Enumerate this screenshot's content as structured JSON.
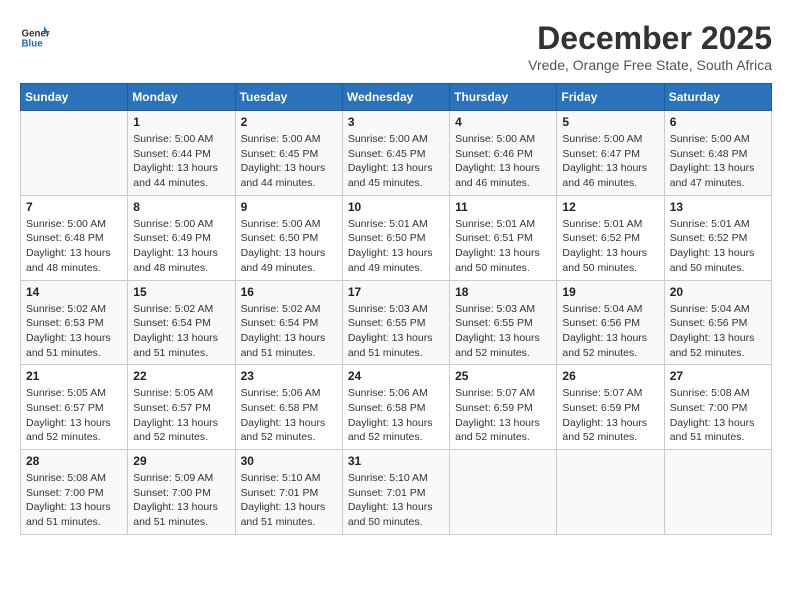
{
  "header": {
    "logo_general": "General",
    "logo_blue": "Blue",
    "month_title": "December 2025",
    "location": "Vrede, Orange Free State, South Africa"
  },
  "days_of_week": [
    "Sunday",
    "Monday",
    "Tuesday",
    "Wednesday",
    "Thursday",
    "Friday",
    "Saturday"
  ],
  "weeks": [
    [
      {
        "day": "",
        "info": ""
      },
      {
        "day": "1",
        "info": "Sunrise: 5:00 AM\nSunset: 6:44 PM\nDaylight: 13 hours\nand 44 minutes."
      },
      {
        "day": "2",
        "info": "Sunrise: 5:00 AM\nSunset: 6:45 PM\nDaylight: 13 hours\nand 44 minutes."
      },
      {
        "day": "3",
        "info": "Sunrise: 5:00 AM\nSunset: 6:45 PM\nDaylight: 13 hours\nand 45 minutes."
      },
      {
        "day": "4",
        "info": "Sunrise: 5:00 AM\nSunset: 6:46 PM\nDaylight: 13 hours\nand 46 minutes."
      },
      {
        "day": "5",
        "info": "Sunrise: 5:00 AM\nSunset: 6:47 PM\nDaylight: 13 hours\nand 46 minutes."
      },
      {
        "day": "6",
        "info": "Sunrise: 5:00 AM\nSunset: 6:48 PM\nDaylight: 13 hours\nand 47 minutes."
      }
    ],
    [
      {
        "day": "7",
        "info": "Sunrise: 5:00 AM\nSunset: 6:48 PM\nDaylight: 13 hours\nand 48 minutes."
      },
      {
        "day": "8",
        "info": "Sunrise: 5:00 AM\nSunset: 6:49 PM\nDaylight: 13 hours\nand 48 minutes."
      },
      {
        "day": "9",
        "info": "Sunrise: 5:00 AM\nSunset: 6:50 PM\nDaylight: 13 hours\nand 49 minutes."
      },
      {
        "day": "10",
        "info": "Sunrise: 5:01 AM\nSunset: 6:50 PM\nDaylight: 13 hours\nand 49 minutes."
      },
      {
        "day": "11",
        "info": "Sunrise: 5:01 AM\nSunset: 6:51 PM\nDaylight: 13 hours\nand 50 minutes."
      },
      {
        "day": "12",
        "info": "Sunrise: 5:01 AM\nSunset: 6:52 PM\nDaylight: 13 hours\nand 50 minutes."
      },
      {
        "day": "13",
        "info": "Sunrise: 5:01 AM\nSunset: 6:52 PM\nDaylight: 13 hours\nand 50 minutes."
      }
    ],
    [
      {
        "day": "14",
        "info": "Sunrise: 5:02 AM\nSunset: 6:53 PM\nDaylight: 13 hours\nand 51 minutes."
      },
      {
        "day": "15",
        "info": "Sunrise: 5:02 AM\nSunset: 6:54 PM\nDaylight: 13 hours\nand 51 minutes."
      },
      {
        "day": "16",
        "info": "Sunrise: 5:02 AM\nSunset: 6:54 PM\nDaylight: 13 hours\nand 51 minutes."
      },
      {
        "day": "17",
        "info": "Sunrise: 5:03 AM\nSunset: 6:55 PM\nDaylight: 13 hours\nand 51 minutes."
      },
      {
        "day": "18",
        "info": "Sunrise: 5:03 AM\nSunset: 6:55 PM\nDaylight: 13 hours\nand 52 minutes."
      },
      {
        "day": "19",
        "info": "Sunrise: 5:04 AM\nSunset: 6:56 PM\nDaylight: 13 hours\nand 52 minutes."
      },
      {
        "day": "20",
        "info": "Sunrise: 5:04 AM\nSunset: 6:56 PM\nDaylight: 13 hours\nand 52 minutes."
      }
    ],
    [
      {
        "day": "21",
        "info": "Sunrise: 5:05 AM\nSunset: 6:57 PM\nDaylight: 13 hours\nand 52 minutes."
      },
      {
        "day": "22",
        "info": "Sunrise: 5:05 AM\nSunset: 6:57 PM\nDaylight: 13 hours\nand 52 minutes."
      },
      {
        "day": "23",
        "info": "Sunrise: 5:06 AM\nSunset: 6:58 PM\nDaylight: 13 hours\nand 52 minutes."
      },
      {
        "day": "24",
        "info": "Sunrise: 5:06 AM\nSunset: 6:58 PM\nDaylight: 13 hours\nand 52 minutes."
      },
      {
        "day": "25",
        "info": "Sunrise: 5:07 AM\nSunset: 6:59 PM\nDaylight: 13 hours\nand 52 minutes."
      },
      {
        "day": "26",
        "info": "Sunrise: 5:07 AM\nSunset: 6:59 PM\nDaylight: 13 hours\nand 52 minutes."
      },
      {
        "day": "27",
        "info": "Sunrise: 5:08 AM\nSunset: 7:00 PM\nDaylight: 13 hours\nand 51 minutes."
      }
    ],
    [
      {
        "day": "28",
        "info": "Sunrise: 5:08 AM\nSunset: 7:00 PM\nDaylight: 13 hours\nand 51 minutes."
      },
      {
        "day": "29",
        "info": "Sunrise: 5:09 AM\nSunset: 7:00 PM\nDaylight: 13 hours\nand 51 minutes."
      },
      {
        "day": "30",
        "info": "Sunrise: 5:10 AM\nSunset: 7:01 PM\nDaylight: 13 hours\nand 51 minutes."
      },
      {
        "day": "31",
        "info": "Sunrise: 5:10 AM\nSunset: 7:01 PM\nDaylight: 13 hours\nand 50 minutes."
      },
      {
        "day": "",
        "info": ""
      },
      {
        "day": "",
        "info": ""
      },
      {
        "day": "",
        "info": ""
      }
    ]
  ]
}
